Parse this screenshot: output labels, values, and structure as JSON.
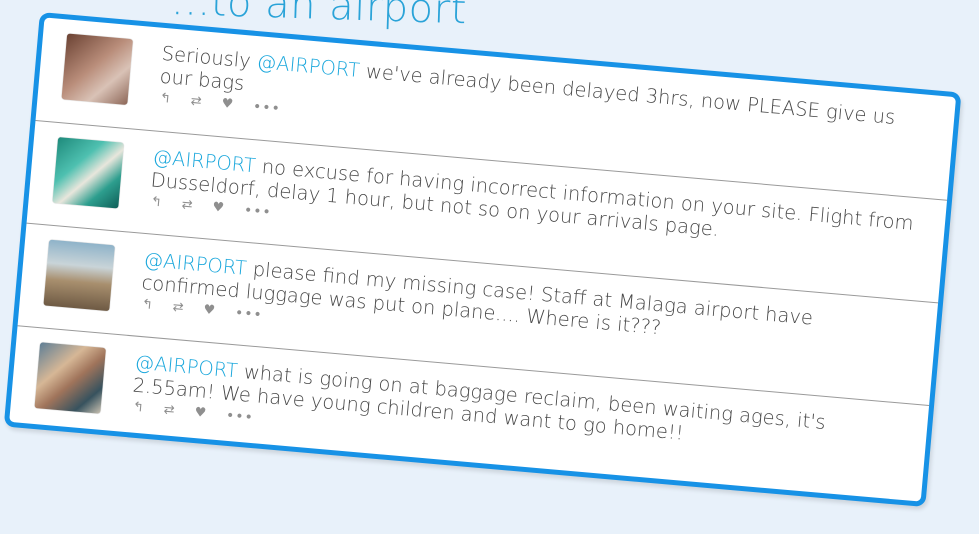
{
  "heading": "...to an airport",
  "tweets": [
    {
      "mention": "@AIRPORT",
      "text_before": "Seriously ",
      "text_after": " we've already been delayed 3hrs, now PLEASE give us our bags"
    },
    {
      "mention": "@AIRPORT",
      "text_before": "",
      "text_after": " no excuse for having incorrect information on your site. Flight from Dusseldorf, delay 1 hour, but not so on your arrivals page."
    },
    {
      "mention": "@AIRPORT",
      "text_before": "",
      "text_after": " please find my missing case! Staff at Malaga airport have confirmed luggage was put on plane.... Where is it???"
    },
    {
      "mention": "@AIRPORT",
      "text_before": "",
      "text_after": " what is going on at baggage reclaim, been waiting ages, it's 2.55am! We have young children and want to go home!!"
    }
  ],
  "icons": {
    "reply": "reply-icon",
    "retweet": "retweet-icon",
    "like": "heart-icon",
    "more": "more-icon"
  },
  "colors": {
    "accent": "#1792e6",
    "mention": "#1aa7dc",
    "heading": "#2aa3d8",
    "background": "#e8f1fa"
  }
}
